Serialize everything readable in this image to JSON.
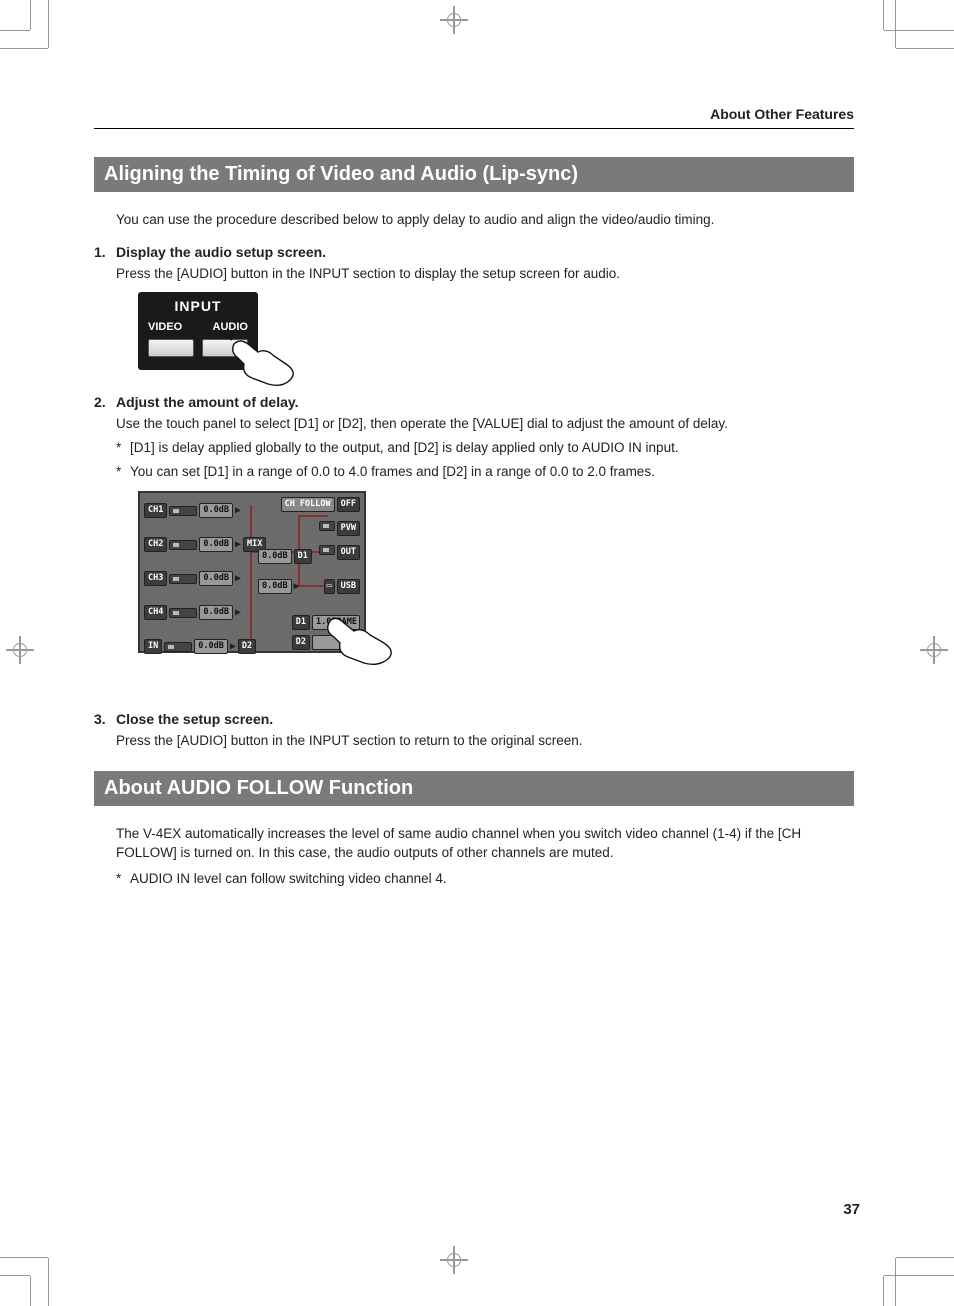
{
  "header": {
    "running": "About Other Features"
  },
  "page_number": "37",
  "section1": {
    "title": "Aligning the Timing of Video and Audio (Lip-sync)",
    "intro": "You can use the procedure described below to apply delay to audio and align the video/audio timing.",
    "steps": [
      {
        "num": "1.",
        "title": "Display the audio setup screen.",
        "body": "Press the [AUDIO] button in the INPUT section to display the setup screen for audio.",
        "panel": {
          "title": "INPUT",
          "left": "VIDEO",
          "right": "AUDIO"
        }
      },
      {
        "num": "2.",
        "title": "Adjust the amount of delay.",
        "body": "Use the touch panel to select [D1] or [D2], then operate the [VALUE] dial to adjust the amount of delay.",
        "notes": [
          "[D1] is delay applied globally to the output, and [D2] is delay applied only to AUDIO IN input.",
          "You can set [D1] in a range of 0.0 to 4.0 frames and [D2] in a range of 0.0 to 2.0 frames."
        ],
        "mixer": {
          "ch_follow_label": "CH FOLLOW",
          "ch_follow_value": "OFF",
          "channels": [
            {
              "name": "CH1",
              "db": "0.0dB"
            },
            {
              "name": "CH2",
              "db": "0.0dB"
            },
            {
              "name": "CH3",
              "db": "0.0dB"
            },
            {
              "name": "CH4",
              "db": "0.0dB"
            }
          ],
          "in_label": "IN",
          "in_db": "0.0dB",
          "mix_label": "MIX",
          "d1_db": "0.0dB",
          "d2_db": "0.0dB",
          "outs": {
            "pvw": "PVW",
            "out": "OUT",
            "usb": "USB"
          },
          "d1_label_a": "D1",
          "d2_label_a": "D2",
          "d1_label_b": "D1",
          "d2_label_b": "D2",
          "d1_value": "1.0FRAME",
          "d2_value": "---"
        }
      },
      {
        "num": "3.",
        "title": "Close the setup screen.",
        "body": "Press the [AUDIO] button in the INPUT section to return to the original screen."
      }
    ]
  },
  "section2": {
    "title": "About AUDIO FOLLOW Function",
    "body": "The V-4EX automatically increases the level of same audio channel when you switch video channel (1-4) if the [CH FOLLOW] is turned on. In this case, the audio outputs of other channels are muted.",
    "note": "AUDIO IN level can follow switching video channel 4."
  }
}
